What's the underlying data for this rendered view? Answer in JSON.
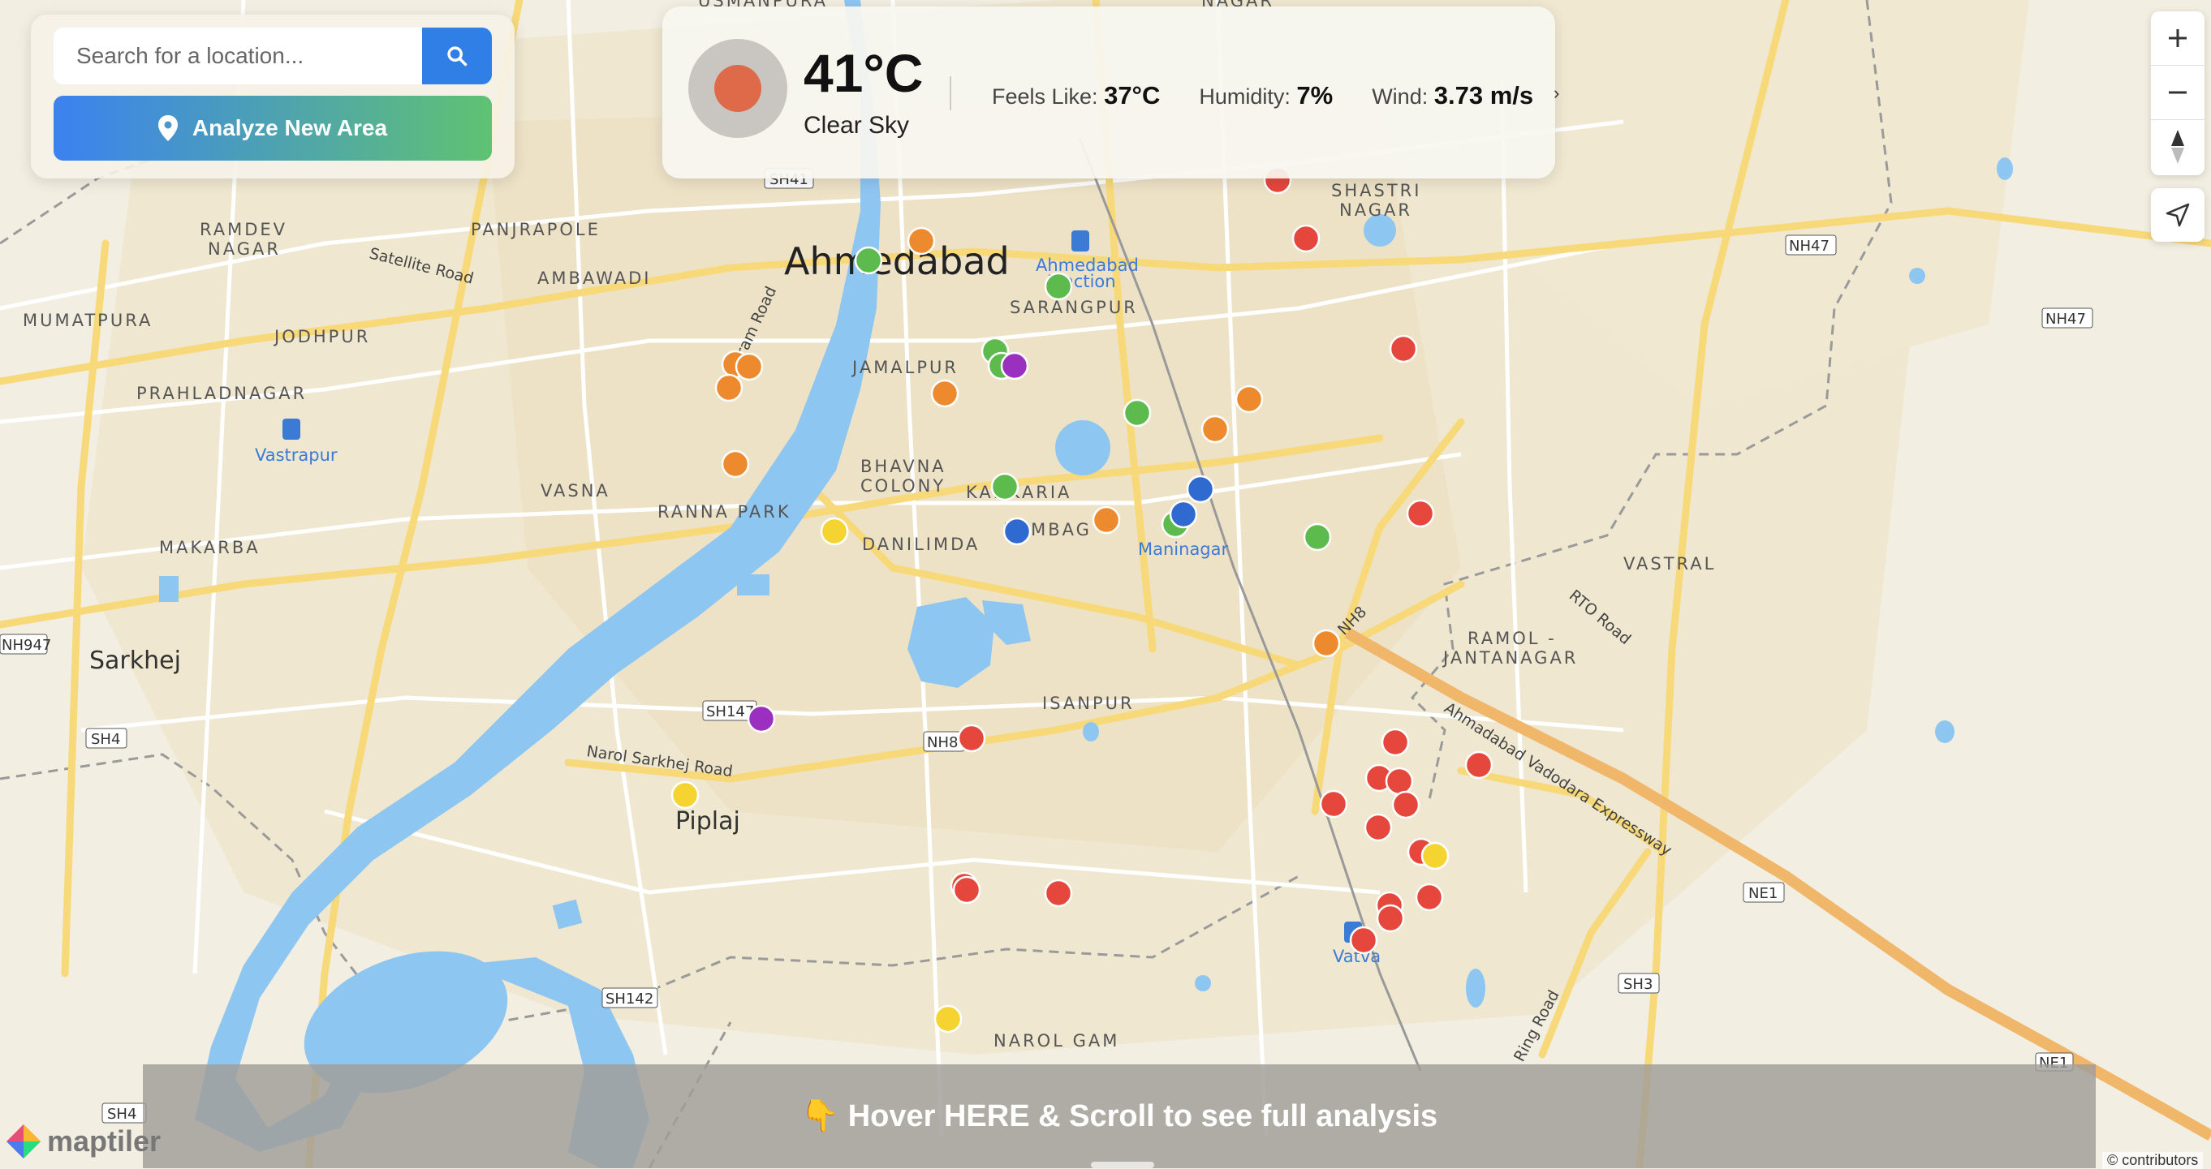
{
  "search": {
    "placeholder": "Search for a location..."
  },
  "analyze_button": {
    "label": "Analyze New Area"
  },
  "weather": {
    "temperature": "41°C",
    "condition": "Clear Sky",
    "feels_like_label": "Feels Like:",
    "feels_like_value": "37°C",
    "humidity_label": "Humidity:",
    "humidity_value": "7%",
    "wind_label": "Wind:",
    "wind_value": "3.73 m/s",
    "icon_color": "#df6a4a"
  },
  "controls": {
    "zoom_in": "+",
    "zoom_out": "−"
  },
  "banner": {
    "text": "👇 Hover HERE & Scroll to see full analysis"
  },
  "branding": {
    "logo_text": "maptiler",
    "attribution": "© contributors"
  },
  "map_labels": {
    "city": "Ahmedabad",
    "towns": [
      "Sarkhej",
      "Piplaj"
    ],
    "stations": [
      "Vastrapur",
      "Ahmedabad Junction",
      "Maninagar",
      "Vatva"
    ],
    "places": [
      "USMANPURA",
      "RAMDEV NAGAR",
      "PANJRAPOLE",
      "AMBAWADI",
      "MUMATPURA",
      "JODHPUR",
      "PRAHLADNAGAR",
      "VASNA",
      "RANNA PARK",
      "MAKARBA",
      "JAMALPUR",
      "BHAVNA COLONY",
      "KANKARIA",
      "DANILIMDA",
      "SARANGPUR",
      "SHASTRI NAGAR",
      "VASTRAL",
      "RAMOL - JANTANAGAR",
      "ISANPUR",
      "NAROL GAM",
      "NAGAR"
    ],
    "roads": [
      "Satellite Road",
      "Narol Sarkhej Road",
      "Ahmadabad Vadodara Expressway",
      "RTO Road",
      "Ring Road",
      "NH8"
    ],
    "shields": [
      "SH41",
      "NH47",
      "NH47",
      "NH947",
      "SH4",
      "SH147",
      "NH8",
      "SH142",
      "SH4",
      "SH3",
      "NE1",
      "NE1"
    ]
  },
  "markers": {
    "colors": {
      "red": "#e5473c",
      "orange": "#ee8a2e",
      "green": "#5dbb4e",
      "purple": "#9b2fc0",
      "yellow": "#f5d432",
      "blue": "#2f6ad0"
    },
    "categories": [
      "red",
      "orange",
      "green",
      "purple",
      "yellow",
      "blue"
    ]
  }
}
